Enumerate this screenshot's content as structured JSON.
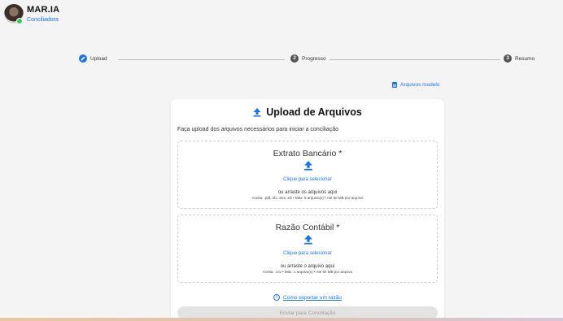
{
  "header": {
    "brand_title": "MAR.IA",
    "brand_subtitle": "Conciliadora",
    "status_color": "#34c759"
  },
  "stepper": {
    "steps": [
      {
        "number": "",
        "label": "Upload",
        "state": "active",
        "icon": "pencil-icon"
      },
      {
        "number": "2",
        "label": "Progresso",
        "state": "todo"
      },
      {
        "number": "3",
        "label": "Resumo",
        "state": "todo"
      }
    ]
  },
  "model_link": {
    "label": "Arquivos modelo",
    "icon": "document-icon"
  },
  "card": {
    "title": "Upload de Arquivos",
    "title_icon": "upload-icon",
    "description": "Faça upload dos arquivos necessários para iniciar a conciliação",
    "dropzones": [
      {
        "title": "Extrato Bancário *",
        "click_label": "Clique para selecionar",
        "drag_label": "ou arraste os arquivos aqui",
        "accept_label": "Aceita: .pdf,.ofx,.xlsx,.xls • Máx. 5 arquivo(s) • Até 50 MB por arquivo"
      },
      {
        "title": "Razão Contábil *",
        "click_label": "Clique para selecionar",
        "drag_label": "ou arraste o arquivo aqui",
        "accept_label": "Aceita: .csv • Máx. 1 arquivo(s) • Até 50 MB por arquivo"
      }
    ],
    "export_link": "Como exportar um razão",
    "submit_label": "Enviar para Conciliação"
  },
  "colors": {
    "accent": "#1a73e8",
    "disabled_bg": "#e3e3e3",
    "disabled_text": "#9e9e9e"
  }
}
